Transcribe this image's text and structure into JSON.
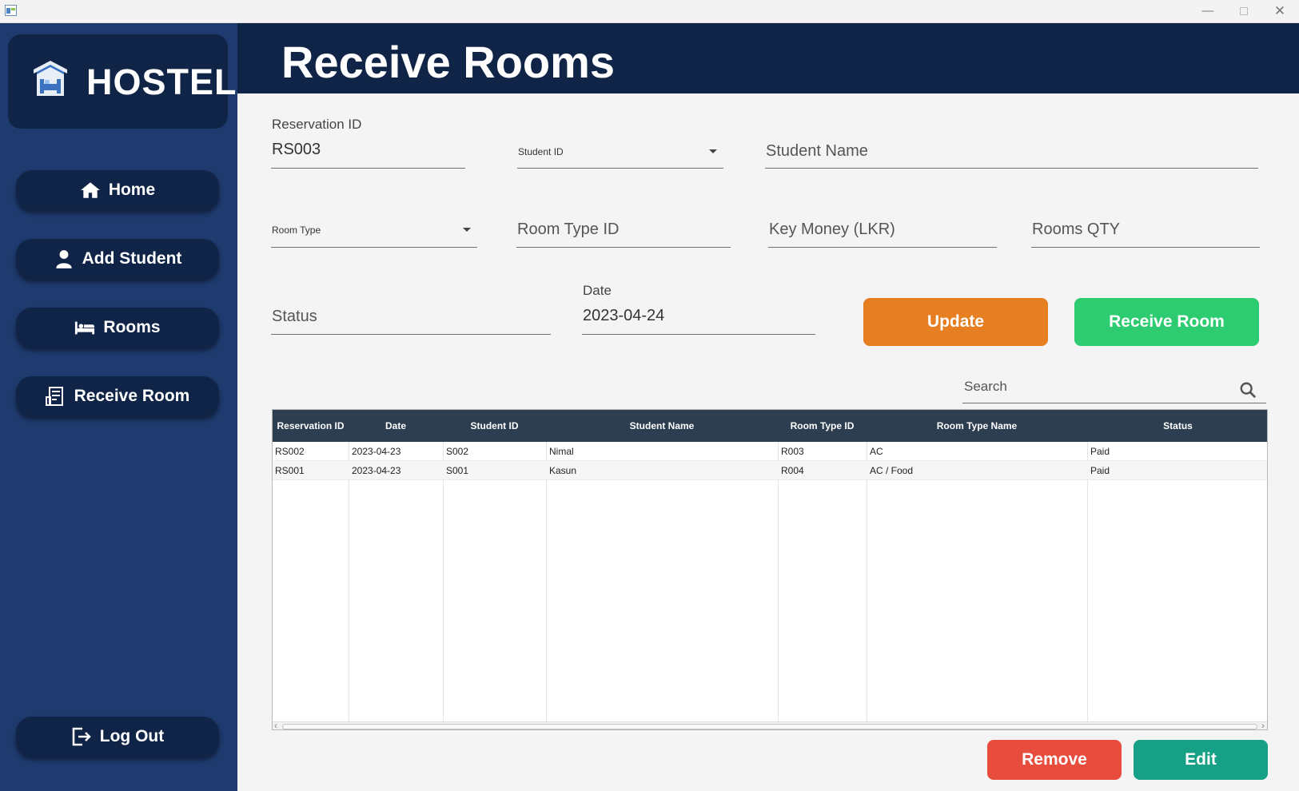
{
  "window": {
    "minimize_glyph": "—",
    "close_glyph": "✕"
  },
  "sidebar": {
    "logo_icon": "hostel-building-icon",
    "logo_text": "HOSTEL",
    "items": [
      {
        "label": "Home",
        "icon": "home-icon"
      },
      {
        "label": "Add Student",
        "icon": "user-icon"
      },
      {
        "label": "Rooms",
        "icon": "bed-icon"
      },
      {
        "label": "Receive Room",
        "icon": "receipt-icon"
      }
    ],
    "logout": {
      "label": "Log Out",
      "icon": "logout-icon"
    }
  },
  "header": {
    "title": "Receive Rooms"
  },
  "form": {
    "reservation_id": {
      "label": "Reservation ID",
      "value": "RS003"
    },
    "student_id": {
      "placeholder": "Student ID"
    },
    "student_name": {
      "placeholder": "Student Name"
    },
    "room_type": {
      "placeholder": "Room Type"
    },
    "room_type_id": {
      "placeholder": "Room Type ID"
    },
    "key_money": {
      "placeholder": "Key Money (LKR)"
    },
    "rooms_qty": {
      "placeholder": "Rooms QTY"
    },
    "status": {
      "placeholder": "Status"
    },
    "date": {
      "label": "Date",
      "value": "2023-04-24"
    },
    "update_label": "Update",
    "receive_label": "Receive Room"
  },
  "search": {
    "placeholder": "Search",
    "icon": "search-icon"
  },
  "table": {
    "columns": [
      "Reservation ID",
      "Date",
      "Student ID",
      "Student Name",
      "Room Type ID",
      "Room Type Name",
      "Status"
    ],
    "rows": [
      [
        "RS002",
        "2023-04-23",
        "S002",
        "Nimal",
        "R003",
        "AC",
        "Paid"
      ],
      [
        "RS001",
        "2023-04-23",
        "S001",
        "Kasun",
        "R004",
        "AC / Food",
        "Paid"
      ]
    ]
  },
  "footer": {
    "remove_label": "Remove",
    "edit_label": "Edit"
  },
  "colors": {
    "sidebar_bg": "#1e3a6e",
    "nav_bg": "#0f2447",
    "update": "#e67e22",
    "receive": "#2ecc71",
    "remove": "#e74c3c",
    "edit": "#16a085",
    "table_header": "#2c3e50"
  }
}
